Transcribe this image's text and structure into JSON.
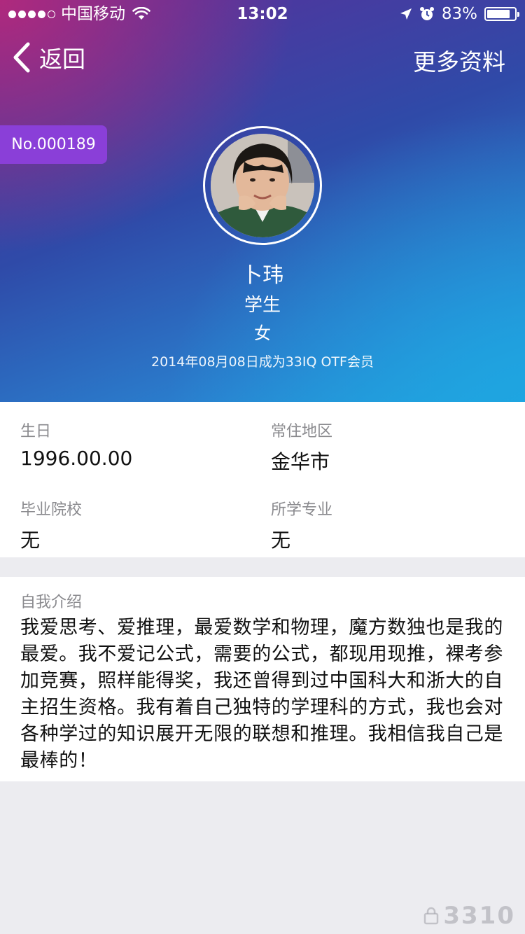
{
  "status_bar": {
    "carrier": "中国移动",
    "time": "13:02",
    "battery": "83%",
    "battery_level": 0.83
  },
  "nav": {
    "back_label": "返回",
    "more_label": "更多资料"
  },
  "profile": {
    "member_no": "No.000189",
    "name": "卜玮",
    "role": "学生",
    "gender": "女",
    "member_since": "2014年08月08日成为33IQ OTF会员"
  },
  "details": {
    "birthday_label": "生日",
    "birthday": "1996.00.00",
    "region_label": "常住地区",
    "region": "金华市",
    "school_label": "毕业院校",
    "school": "无",
    "major_label": "所学专业",
    "major": "无"
  },
  "intro": {
    "label": "自我介绍",
    "text": "我爱思考、爱推理，最爱数学和物理，魔方数独也是我的最爱。我不爱记公式，需要的公式，都现用现推，裸考参加竞赛，照样能得奖，我还曾得到过中国科大和浙大的自主招生资格。我有着自己独特的学理科的方式，我也会对各种学过的知识展开无限的联想和推理。我相信我自己是最棒的！"
  },
  "watermark": "3310",
  "colors": {
    "accent_badge": "#8a3fd8",
    "hero_start": "#5a2f9a",
    "hero_end": "#23a4de",
    "page_bg": "#ececf0"
  }
}
